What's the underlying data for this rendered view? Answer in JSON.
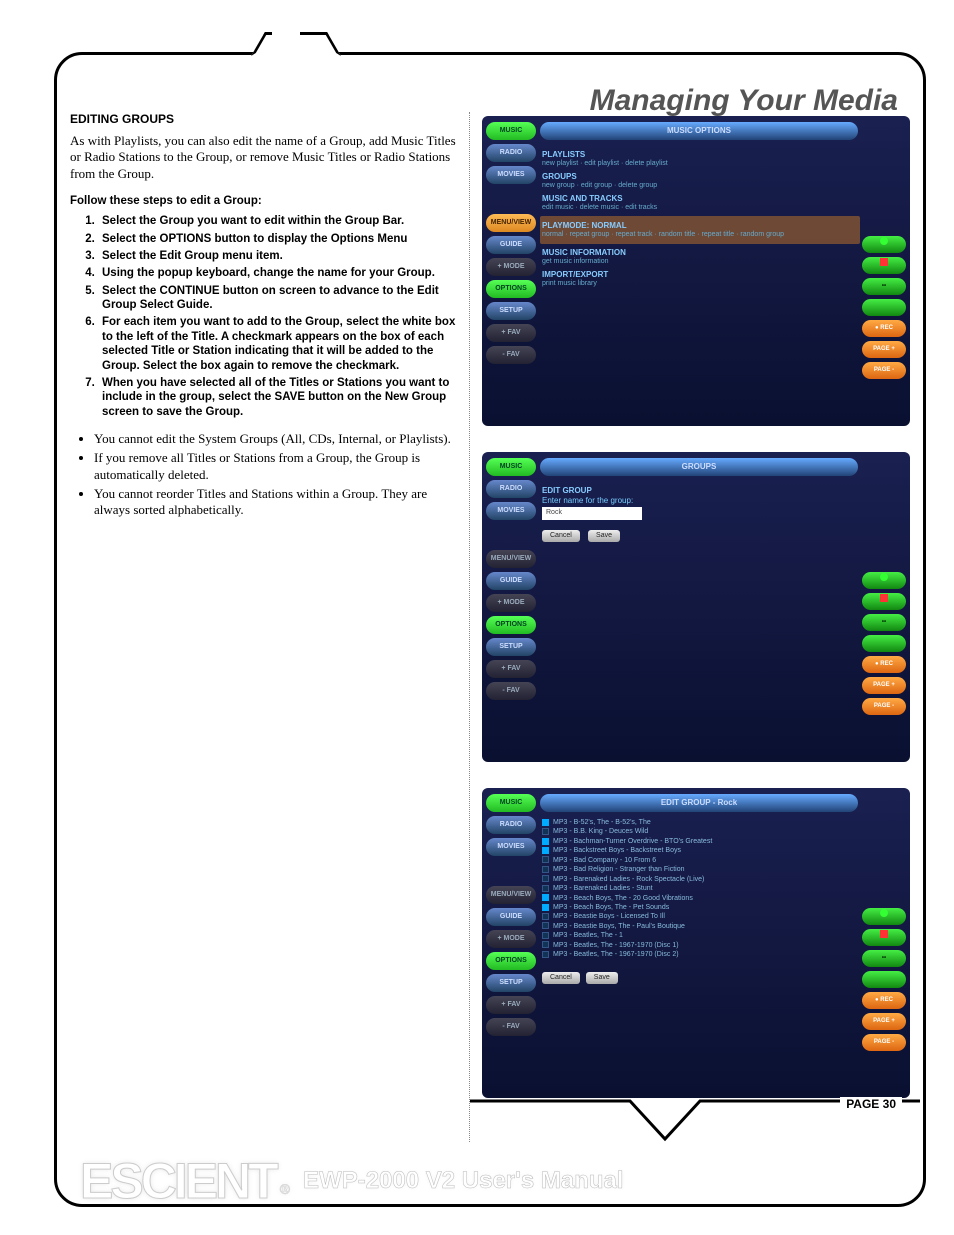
{
  "page_title": "Managing Your Media",
  "section_heading": "EDITING GROUPS",
  "intro_para": "As with Playlists, you can also edit the name of a Group, add Music Titles or Radio Stations to the Group, or remove Music Titles or Radio Stations from the Group.",
  "follow_label": "Follow these steps to edit a Group:",
  "steps": [
    "Select the Group you want to edit within the Group Bar.",
    "Select the OPTIONS button to display the Options Menu",
    "Select the Edit Group menu item.",
    "Using the popup keyboard, change the name for your Group.",
    "Select the CONTINUE button on screen to advance to the Edit Group Select Guide.",
    "For each item you want to add to the Group, select the white box to the left of the Title. A checkmark appears on the box of each selected Title or Station indicating that it will be added to the Group. Select the box again to remove the checkmark.",
    "When you have selected all of the Titles or Stations you want to include in the group, select the SAVE button on the New Group screen to save the Group."
  ],
  "notes": [
    "You cannot edit the System Groups (All, CDs, Internal, or Playlists).",
    "If you remove all Titles or Stations from a Group, the Group is automatically deleted.",
    "You cannot reorder Titles and Stations within a Group. They are always sorted alphabetically."
  ],
  "nav": {
    "music": "MUSIC",
    "radio": "RADIO",
    "movies": "MOVIES",
    "menuview": "MENU/VIEW",
    "guide": "GUIDE",
    "mode": "+ MODE",
    "options": "OPTIONS",
    "setup": "SETUP",
    "favplus": "+ FAV",
    "favminus": "- FAV"
  },
  "right": {
    "rec": "● REC",
    "pageup": "PAGE +",
    "pagedn": "PAGE -"
  },
  "screen1": {
    "title": "MUSIC OPTIONS",
    "rows": [
      {
        "h": "PLAYLISTS",
        "s": "new playlist · edit playlist · delete playlist"
      },
      {
        "h": "GROUPS",
        "s": "new group · edit group · delete group"
      },
      {
        "h": "MUSIC AND TRACKS",
        "s": "edit music · delete music · edit tracks"
      },
      {
        "h": "PLAYMODE: NORMAL",
        "s": "normal · repeat group · repeat track · random title · repeat title · random group",
        "hl": true
      },
      {
        "h": "MUSIC INFORMATION",
        "s": "get music information"
      },
      {
        "h": "IMPORT/EXPORT",
        "s": "print music library"
      }
    ]
  },
  "screen2": {
    "title": "GROUPS",
    "header": "EDIT GROUP",
    "prompt": "Enter name for the group:",
    "input": "Rock",
    "btn_cancel": "Cancel",
    "btn_save": "Save"
  },
  "screen3": {
    "title": "EDIT GROUP - Rock",
    "tracks": [
      {
        "c": true,
        "t": "MP3 - B-52's, The - B-52's, The"
      },
      {
        "c": false,
        "t": "MP3 - B.B. King - Deuces Wild"
      },
      {
        "c": true,
        "t": "MP3 - Bachman-Turner Overdrive - BTO's Greatest"
      },
      {
        "c": true,
        "t": "MP3 - Backstreet Boys - Backstreet Boys"
      },
      {
        "c": false,
        "t": "MP3 - Bad Company - 10 From 6"
      },
      {
        "c": false,
        "t": "MP3 - Bad Religion - Stranger than Fiction"
      },
      {
        "c": false,
        "t": "MP3 - Barenaked Ladies - Rock Spectacle (Live)"
      },
      {
        "c": false,
        "t": "MP3 - Barenaked Ladies - Stunt"
      },
      {
        "c": true,
        "t": "MP3 - Beach Boys, The - 20 Good Vibrations"
      },
      {
        "c": true,
        "t": "MP3 - Beach Boys, The - Pet Sounds"
      },
      {
        "c": false,
        "t": "MP3 - Beastie Boys - Licensed To Ill"
      },
      {
        "c": false,
        "t": "MP3 - Beastie Boys, The - Paul's Boutique"
      },
      {
        "c": false,
        "t": "MP3 - Beatles, The - 1"
      },
      {
        "c": false,
        "t": "MP3 - Beatles, The - 1967-1970 (Disc 1)"
      },
      {
        "c": false,
        "t": "MP3 - Beatles, The - 1967-1970 (Disc 2)"
      }
    ],
    "btn_cancel": "Cancel",
    "btn_save": "Save"
  },
  "page_number": "PAGE 30",
  "brand": "ESCIENT",
  "reg": "®",
  "manual_title": "EWP-2000 V2 User's Manual"
}
